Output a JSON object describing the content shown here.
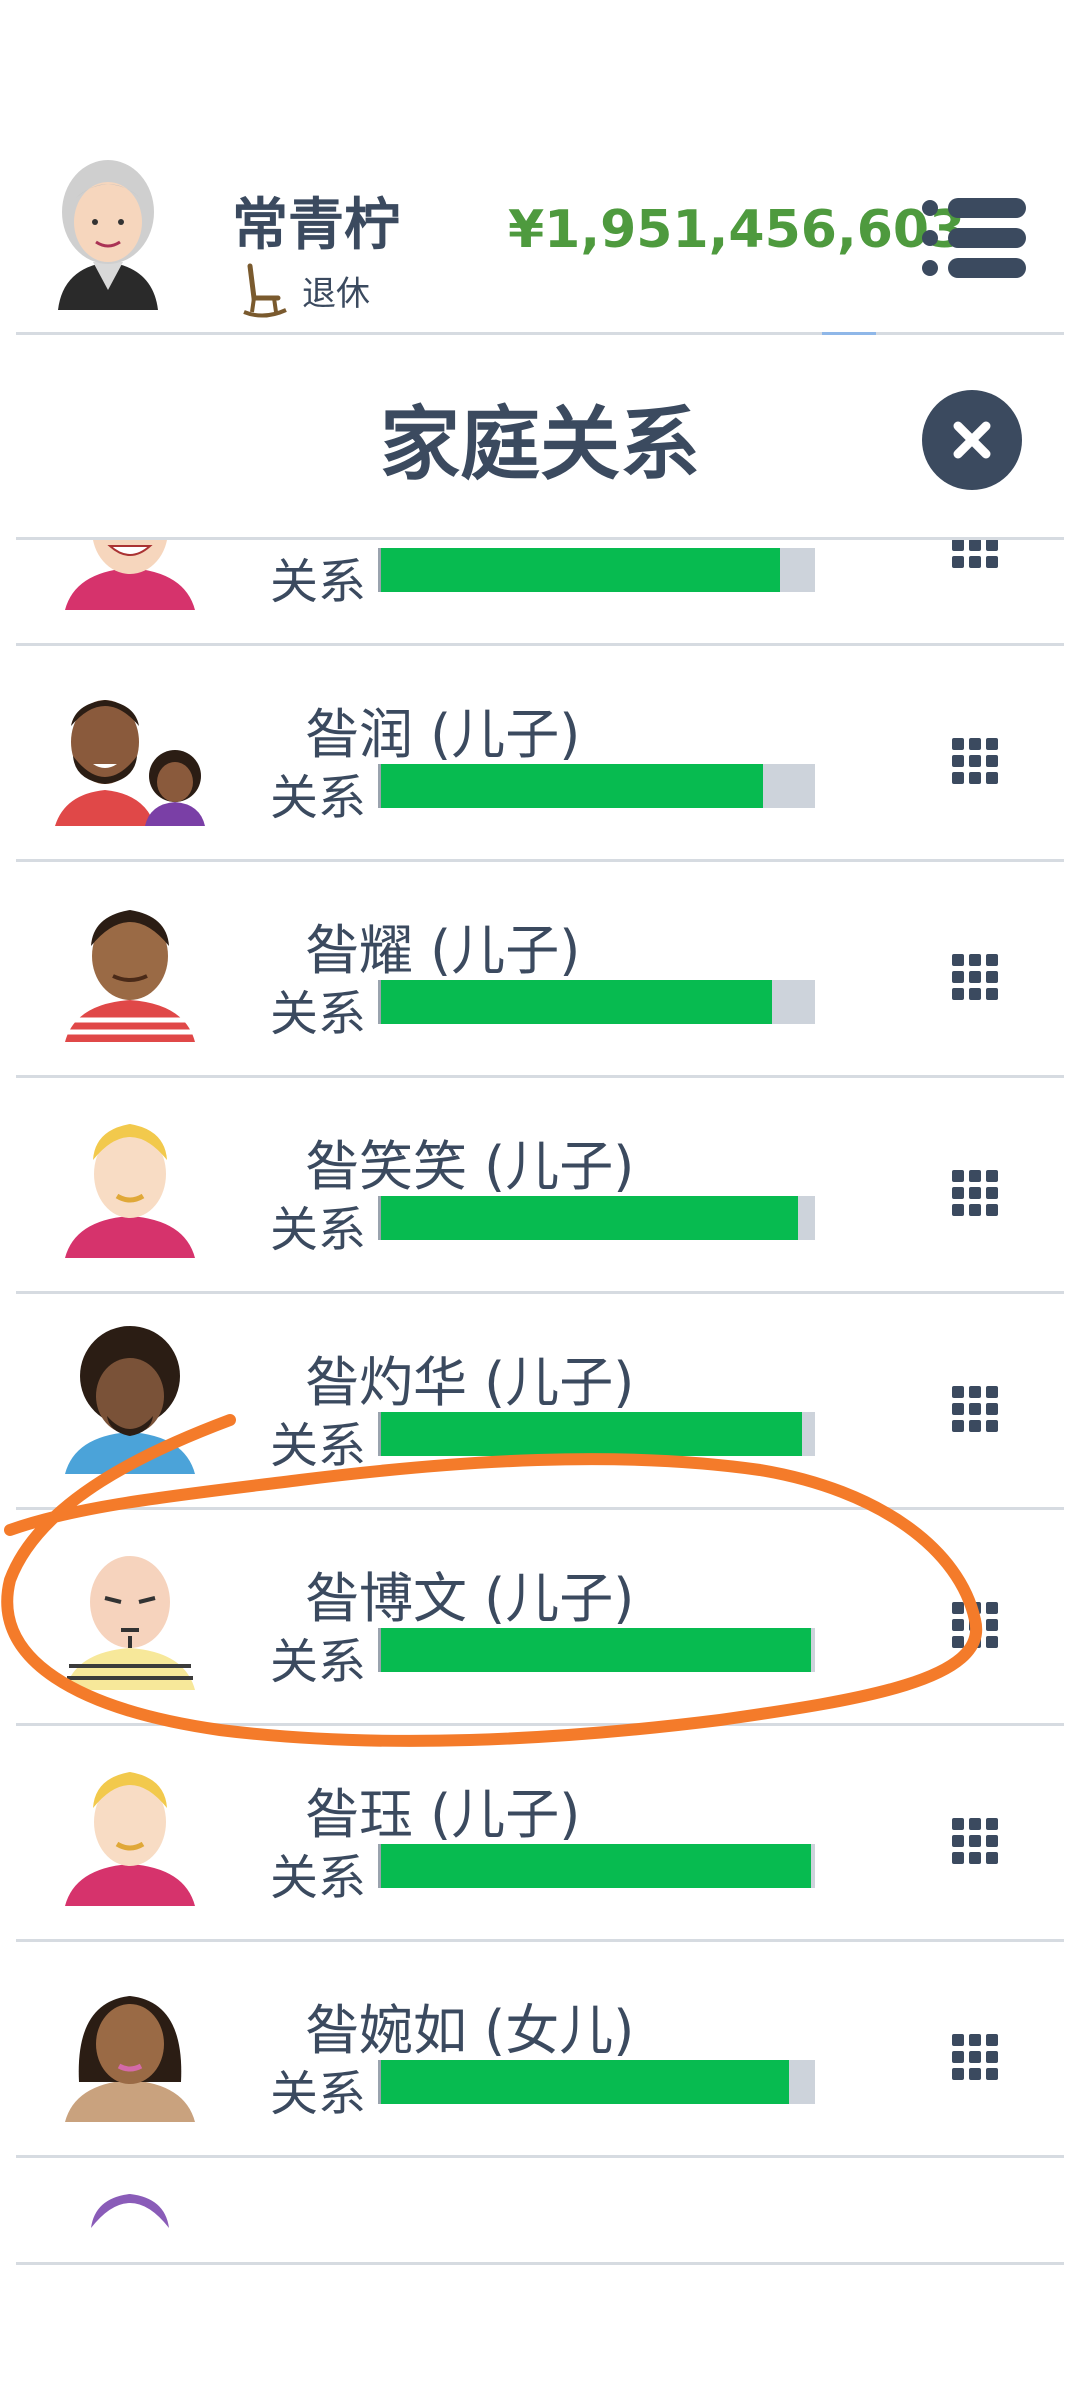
{
  "player": {
    "name": "常青柠",
    "status": "退休",
    "money": "¥1,951,456,603",
    "avatar_icon": "elderly-woman-avatar"
  },
  "modal": {
    "title": "家庭关系",
    "close_icon": "close-icon"
  },
  "colors": {
    "bar_fill": "#07bb50",
    "bar_track": "#cdd3db",
    "money": "#4e9a3e",
    "text": "#3b4a5f",
    "annotation": "#f47b2a"
  },
  "relationships": [
    {
      "name": "",
      "rel_label": "关系",
      "level": 0.92,
      "avatar": "smiling-person-avatar"
    },
    {
      "name": "昝润 (儿子)",
      "rel_label": "关系",
      "level": 0.88,
      "avatar": "man-with-child-avatar"
    },
    {
      "name": "昝耀 (儿子)",
      "rel_label": "关系",
      "level": 0.9,
      "avatar": "curly-hair-man-avatar"
    },
    {
      "name": "昝笑笑 (儿子)",
      "rel_label": "关系",
      "level": 0.96,
      "avatar": "blond-man-avatar"
    },
    {
      "name": "昝灼华 (儿子)",
      "rel_label": "关系",
      "level": 0.97,
      "avatar": "afro-man-avatar"
    },
    {
      "name": "昝博文 (儿子)",
      "rel_label": "关系",
      "level": 0.99,
      "avatar": "bald-man-avatar"
    },
    {
      "name": "昝珏 (儿子)",
      "rel_label": "关系",
      "level": 0.99,
      "avatar": "blond-man-avatar"
    },
    {
      "name": "昝婉如 (女儿)",
      "rel_label": "关系",
      "level": 0.94,
      "avatar": "woman-avatar"
    }
  ]
}
